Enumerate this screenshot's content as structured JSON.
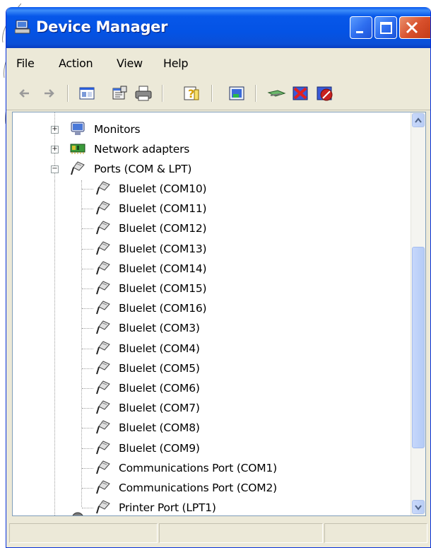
{
  "window": {
    "title": "Device Manager"
  },
  "menu": [
    {
      "label": "File"
    },
    {
      "label": "Action"
    },
    {
      "label": "View"
    },
    {
      "label": "Help"
    }
  ],
  "toolbar": {
    "buttons": [
      {
        "icon": "back-arrow-icon"
      },
      {
        "icon": "forward-arrow-icon"
      },
      {
        "icon": "show-hide-console-tree-icon"
      },
      {
        "icon": "properties-icon"
      },
      {
        "icon": "print-icon"
      },
      {
        "icon": "help-icon"
      },
      {
        "icon": "scan-hardware-changes-icon"
      },
      {
        "icon": "update-driver-icon"
      },
      {
        "icon": "uninstall-icon"
      },
      {
        "icon": "disable-icon"
      }
    ]
  },
  "tree": {
    "categories": [
      {
        "label": "Monitors",
        "expanded": false
      },
      {
        "label": "Network adapters",
        "expanded": false
      },
      {
        "label": "Ports (COM & LPT)",
        "expanded": true
      }
    ],
    "ports": [
      "Bluelet (COM10)",
      "Bluelet (COM11)",
      "Bluelet (COM12)",
      "Bluelet (COM13)",
      "Bluelet (COM14)",
      "Bluelet (COM15)",
      "Bluelet (COM16)",
      "Bluelet (COM3)",
      "Bluelet (COM4)",
      "Bluelet (COM5)",
      "Bluelet (COM6)",
      "Bluelet (COM7)",
      "Bluelet (COM8)",
      "Bluelet (COM9)",
      "Communications Port (COM1)",
      "Communications Port (COM2)",
      "Printer Port (LPT1)"
    ]
  },
  "colors": {
    "titlebar": "#0453e5",
    "close_button": "#d8502c",
    "face": "#ece9d8",
    "scrollbar_thumb": "#b4cbf6"
  }
}
